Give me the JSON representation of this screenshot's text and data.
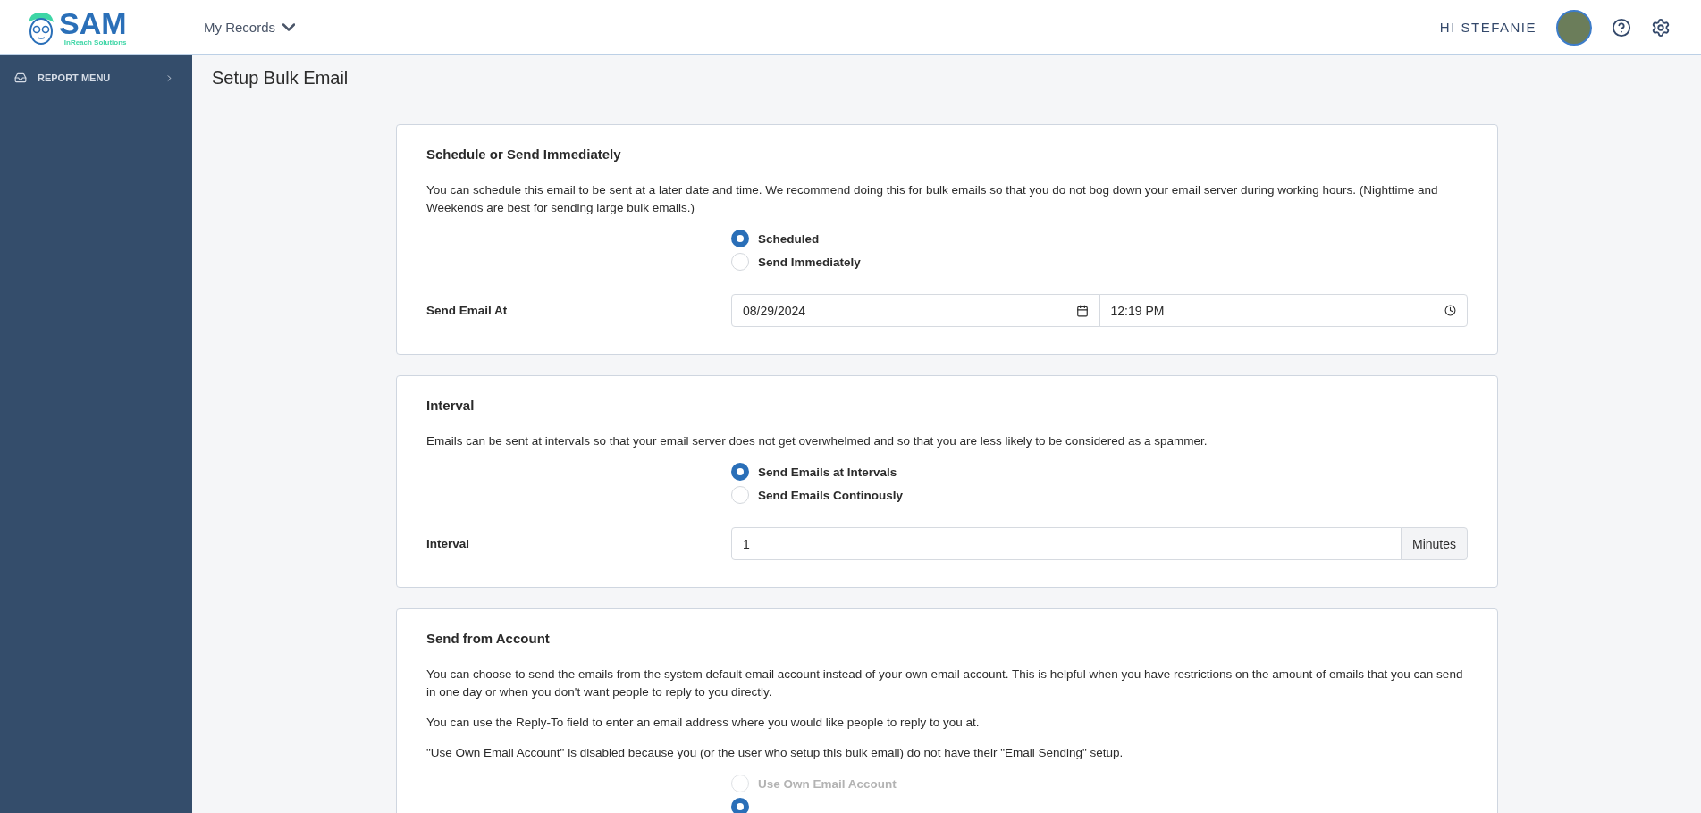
{
  "header": {
    "logo": {
      "name": "SAM",
      "tagline": "InReach Solutions"
    },
    "nav_menu": {
      "label": "My Records"
    },
    "greeting": "HI STEFANIE"
  },
  "sidebar": {
    "items": [
      {
        "label": "REPORT MENU",
        "selected": false
      }
    ]
  },
  "page_title": "Setup Bulk Email",
  "sections": [
    {
      "title": "Schedule or Send Immediately",
      "paragraphs": [
        "You can schedule this email to be sent at a later date and time. We recommend doing this for bulk emails so that you do not bog down your email server during working hours. (Nighttime and Weekends are best for sending large bulk emails.)"
      ],
      "options": [
        {
          "label": "Scheduled",
          "selected": true
        },
        {
          "label": "Send Immediately",
          "selected": false
        }
      ],
      "field": {
        "kind": "datetime",
        "label": "Send Email At",
        "date": "08/29/2024",
        "time": "12:19 PM"
      }
    },
    {
      "title": "Interval",
      "paragraphs": [
        "Emails can be sent at intervals so that your email server does not get overwhelmed and so that you are less likely to be considered as a spammer."
      ],
      "options": [
        {
          "label": "Send Emails at Intervals",
          "selected": true
        },
        {
          "label": "Send Emails Continously",
          "selected": false
        }
      ],
      "field": {
        "kind": "number",
        "label": "Interval",
        "value": "1",
        "unit": "Minutes"
      }
    },
    {
      "title": "Send from Account",
      "paragraphs": [
        "You can choose to send the emails from the system default email account instead of your own email account. This is helpful when you have restrictions on the amount of emails that you can send in one day or when you don't want people to reply to you directly.",
        "You can use the Reply-To field to enter an email address where you would like people to reply to you at.",
        "\"Use Own Email Account\" is disabled because you (or the user who setup this bulk email) do not have their \"Email Sending\" setup."
      ],
      "options": [
        {
          "label": "Use Own Email Account",
          "selected": false,
          "disabled": true
        },
        {
          "selected": true
        }
      ]
    }
  ]
}
